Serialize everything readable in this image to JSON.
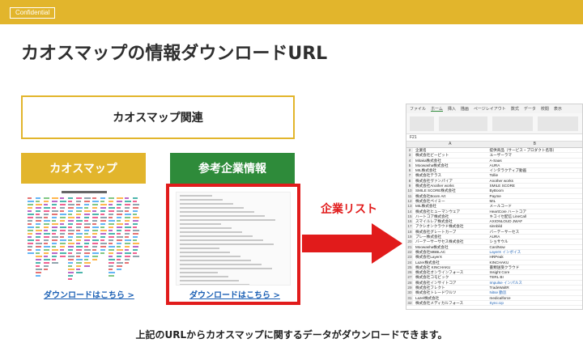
{
  "header": {
    "badge": "Confidential",
    "bar_color": "#e2b52c"
  },
  "title": "カオスマップの情報ダウンロードURL",
  "related_box": {
    "label": "カオスマップ関連"
  },
  "left_card": {
    "label": "カオスマップ",
    "link": "ダウンロードはこちら >"
  },
  "right_card": {
    "label": "参考企業情報",
    "link": "ダウンロードはこちら >"
  },
  "arrow_label": "企業リスト",
  "spreadsheet": {
    "tabs": [
      "ファイル",
      "ホーム",
      "挿入",
      "描画",
      "ページレイアウト",
      "数式",
      "データ",
      "校閲",
      "表示"
    ],
    "cell_ref": "F21",
    "columns": [
      "A",
      "B"
    ],
    "rows": [
      [
        "企業名",
        "提供商品（サービス・プロダクト名等）"
      ],
      [
        "株式会社ビーピット",
        "ユーザーラマ"
      ],
      [
        "Mitaka株式会社",
        "A-Saas"
      ],
      [
        "Moowasha株式会社",
        "AURA"
      ],
      [
        "MIL株式会社",
        "インタラクティブ動画"
      ],
      [
        "株式会社テラス",
        "Tollie"
      ],
      [
        "株式会社ヴァンパイア",
        "Another works"
      ],
      [
        "株式会社Another works",
        "SMILE SCORE"
      ],
      [
        "SMILE SCORE株式会社",
        "ByBoom"
      ],
      [
        "株式会社Boom Art",
        "Payme"
      ],
      [
        "株式会社ペイミー",
        "MIL"
      ],
      [
        "MIL株式会社",
        "メールコード"
      ],
      [
        "株式会社ヒューマンウェア",
        "HeartCore ハートコア"
      ],
      [
        "ハートコア株式会社",
        "キコイセ配信 LineCall"
      ],
      [
        "スマイルレア株式会社",
        "AXIONLOUD JWAF"
      ],
      [
        "アクシオンクラウド株式会社",
        "sinnbild"
      ],
      [
        "株式会社グレートカーブ",
        "バーテーサーセス"
      ],
      [
        "プレー株式会社",
        "AURA"
      ],
      [
        "バーテーサーサセス株式会社",
        "ショサウル"
      ],
      [
        "Moowasha株式会社",
        "CardNow"
      ],
      [
        "株式会社MBBLAC",
        "LayerX インボイス"
      ],
      [
        "株式会社LayerX",
        "HRPeak"
      ],
      [
        "Lazer株式会社",
        "KINCHAKU"
      ],
      [
        "株式会社 KINCHAKU",
        "書類送受クラウド"
      ],
      [
        "株式会社オンラインフォース",
        "Insight Core"
      ],
      [
        "株式会社コモビック",
        "TERL BI"
      ],
      [
        "株式会社インサイトコア",
        "Impulse インパルス"
      ],
      [
        "株式会社フレクト",
        "TradeWaltR"
      ],
      [
        "株式会社トレードワルツ",
        "Nitse 勤怠"
      ],
      [
        "Lazel株式会社",
        "medicalforce"
      ],
      [
        "株式会社メディカルフォース",
        "Sync.Up"
      ]
    ]
  },
  "caption": "上記のURLからカオスマップに関するデータがダウンロードできます。"
}
